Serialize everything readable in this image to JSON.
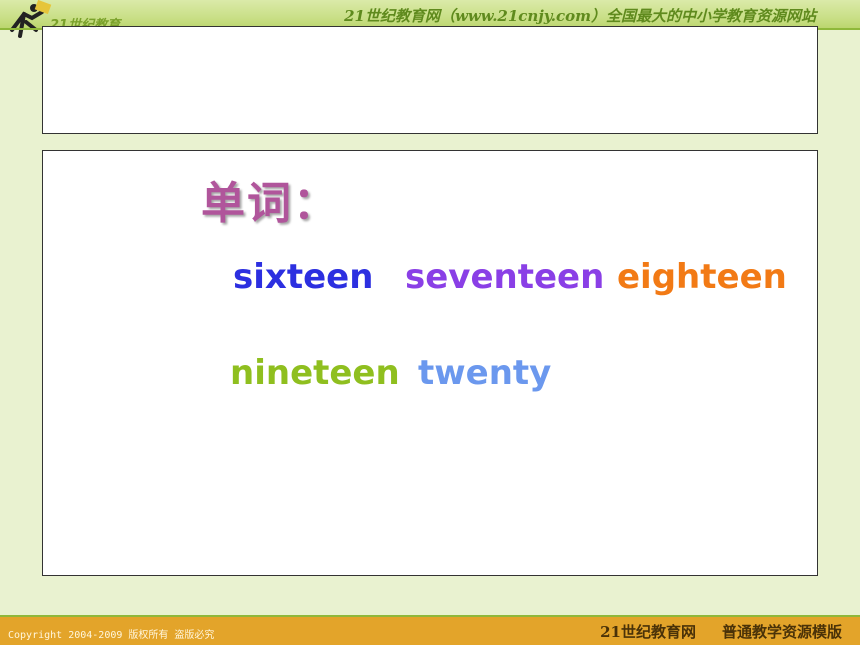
{
  "header": {
    "logo_text": "21世纪教育",
    "slogan": "21世纪教育网（www.21cnjy.com）全国最大的中小学教育资源网站"
  },
  "lesson": {
    "heading": "单词：",
    "words": [
      {
        "text": "sixteen",
        "color": "#2c2fe0"
      },
      {
        "text": "seventeen",
        "color": "#8a3fe6"
      },
      {
        "text": "eighteen",
        "color": "#f27a15"
      },
      {
        "text": "nineteen",
        "color": "#8fbf1f"
      },
      {
        "text": "twenty",
        "color": "#6b98ee"
      }
    ]
  },
  "footer": {
    "copyright": "Copyright 2004-2009 版权所有 盗版必究",
    "site_name": "21世纪教育网",
    "tagline": "普通教学资源模版"
  },
  "colors": {
    "heading": "#b0559b",
    "footer_bar": "#e3a42a",
    "header_bar": "#c9df86"
  }
}
